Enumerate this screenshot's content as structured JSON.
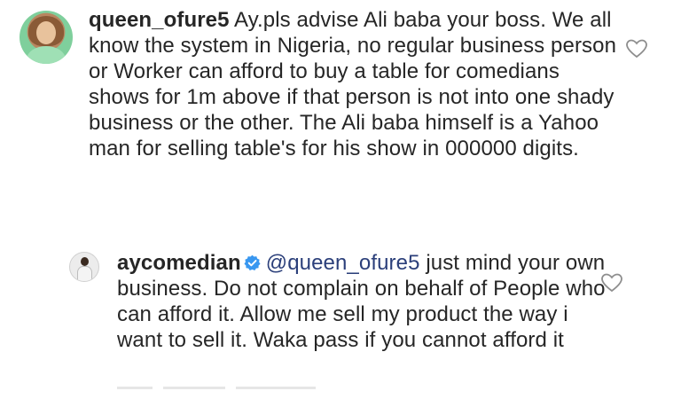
{
  "comments": [
    {
      "username": "queen_ofure5",
      "text": "Ay.pls advise Ali baba your boss. We all know the system in Nigeria, no regular business person or Worker can afford to buy a table for comedians shows for 1m above if that person is not into one shady business or the other.  The Ali baba himself is a Yahoo man for selling table's for his show in 000000 digits.",
      "verified": false,
      "like_icon": "heart-outline-icon"
    },
    {
      "username": "aycomedian",
      "mention": "@queen_ofure5",
      "text": " just mind your own business. Do not complain on behalf of People who can afford it. Allow me sell my product the way i want to sell it. Waka pass if you cannot afford it",
      "verified": true,
      "verified_color": "#3897f0",
      "like_icon": "heart-outline-icon"
    }
  ],
  "colors": {
    "text": "#262626",
    "mention": "#2b3f7a",
    "verified": "#3897f0",
    "heart_stroke": "#8e8e8e"
  }
}
